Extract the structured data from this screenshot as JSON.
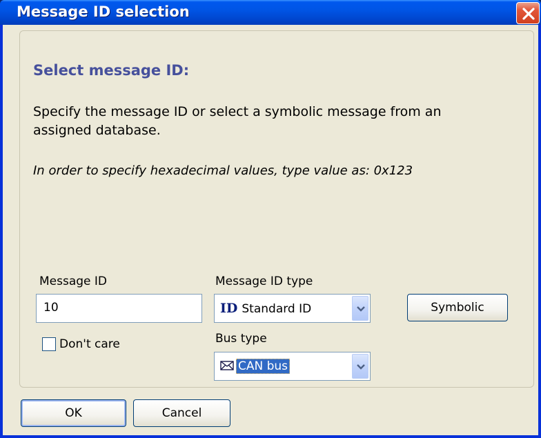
{
  "window": {
    "title": "Message ID selection"
  },
  "content": {
    "heading": "Select message ID:",
    "description": "Specify the message ID or select a symbolic message from an assigned database.",
    "hint": "In order to specify hexadecimal values, type value as: 0x123"
  },
  "message_id": {
    "label": "Message ID",
    "value": "10",
    "dont_care_label": "Don't care",
    "dont_care_checked": false
  },
  "message_id_type": {
    "label": "Message ID type",
    "icon_text": "ID",
    "selected": "Standard ID"
  },
  "bus_type": {
    "label": "Bus type",
    "icon": "envelope-icon",
    "selected": "CAN bus"
  },
  "buttons": {
    "symbolic": "Symbolic",
    "ok": "OK",
    "cancel": "Cancel"
  },
  "colors": {
    "title_bar": "#0055e5",
    "heading": "#46509c",
    "dialog_bg": "#ece9d8",
    "selection": "#316ac5",
    "close_button": "#d1401f"
  }
}
